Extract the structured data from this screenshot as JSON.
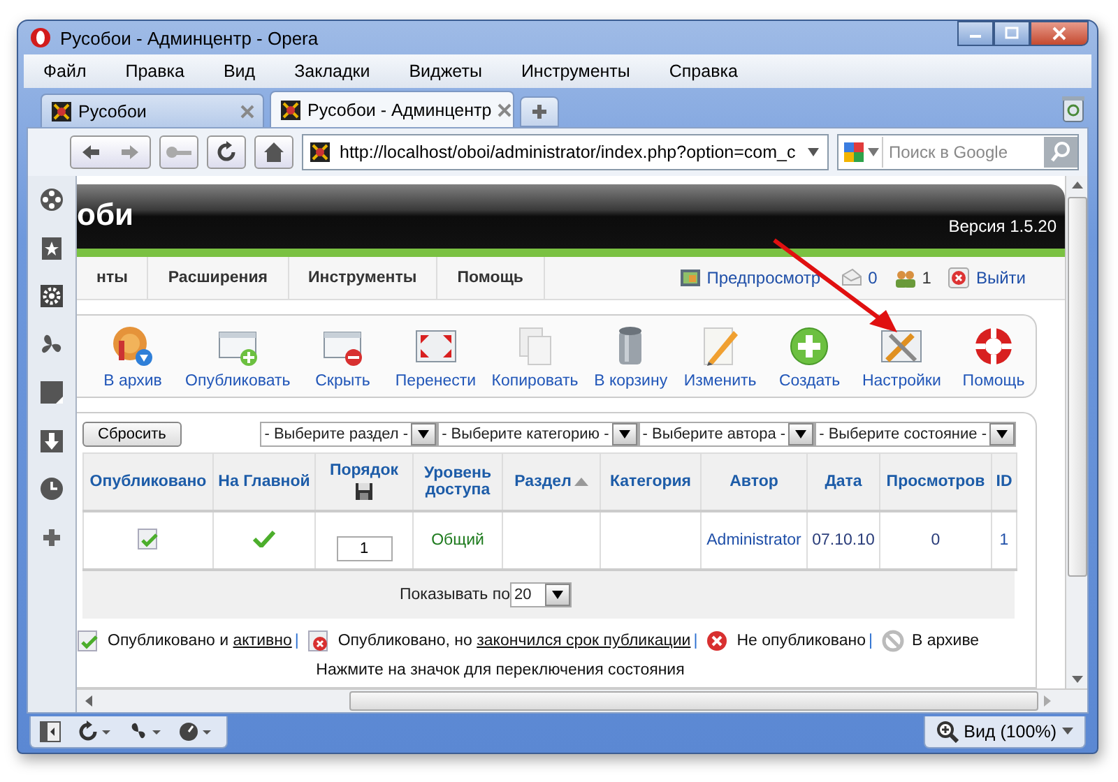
{
  "window": {
    "title": "Русобои - Админцентр - Opera"
  },
  "menu": [
    "Файл",
    "Правка",
    "Вид",
    "Закладки",
    "Виджеты",
    "Инструменты",
    "Справка"
  ],
  "tabs": [
    {
      "label": "Русобои",
      "selected": false
    },
    {
      "label": "Русобои - Админцентр",
      "selected": true
    }
  ],
  "address": {
    "url": "http://localhost/oboi/administrator/index.php?option=com_c"
  },
  "search": {
    "placeholder": "Поиск в Google"
  },
  "page": {
    "logo": "оби",
    "version": "Версия 1.5.20",
    "nav": [
      "нты",
      "Расширения",
      "Инструменты",
      "Помощь"
    ],
    "status": {
      "preview": "Предпросмотр",
      "messages": "0",
      "users": "1",
      "logout": "Выйти"
    },
    "toolbar": [
      "В архив",
      "Опубликовать",
      "Скрыть",
      "Перенести",
      "Копировать",
      "В корзину",
      "Изменить",
      "Создать",
      "Настройки",
      "Помощь"
    ],
    "filters": {
      "reset": "Сбросить",
      "selects": [
        "- Выберите раздел -",
        "- Выберите категорию -",
        "- Выберите автора -",
        "- Выберите состояние -"
      ]
    },
    "table": {
      "columns": [
        {
          "label": "Опубликовано",
          "kind": "text"
        },
        {
          "label": "На Главной",
          "kind": "text"
        },
        {
          "label": "Порядок",
          "kind": "order"
        },
        {
          "label": "Уровень доступа",
          "kind": "text"
        },
        {
          "label": "Раздел",
          "kind": "text",
          "sorted": true
        },
        {
          "label": "Категория",
          "kind": "text"
        },
        {
          "label": "Автор",
          "kind": "text"
        },
        {
          "label": "Дата",
          "kind": "text"
        },
        {
          "label": "Просмотров",
          "kind": "text"
        },
        {
          "label": "ID",
          "kind": "text"
        }
      ],
      "rows": [
        {
          "published": true,
          "featured": true,
          "order": "1",
          "access": "Общий",
          "author": "Administrator",
          "date": "07.10.10",
          "hits": "0",
          "id": "1"
        }
      ]
    },
    "pagination": {
      "label": "Показывать по",
      "value": "20"
    },
    "legend": [
      {
        "kind": "published",
        "text": "Опубликовано и ",
        "link": "активно",
        "separator": "|"
      },
      {
        "kind": "expired",
        "text": "Опубликовано, но ",
        "link": "закончился срок публикации",
        "separator": "|"
      },
      {
        "kind": "unpublished",
        "text": "Не опубликовано",
        "separator": "|"
      },
      {
        "kind": "archived",
        "text": "В архиве"
      }
    ],
    "note": "Нажмите на значок для переключения состояния"
  },
  "status_bar": {
    "zoom": "Вид (100%)"
  }
}
